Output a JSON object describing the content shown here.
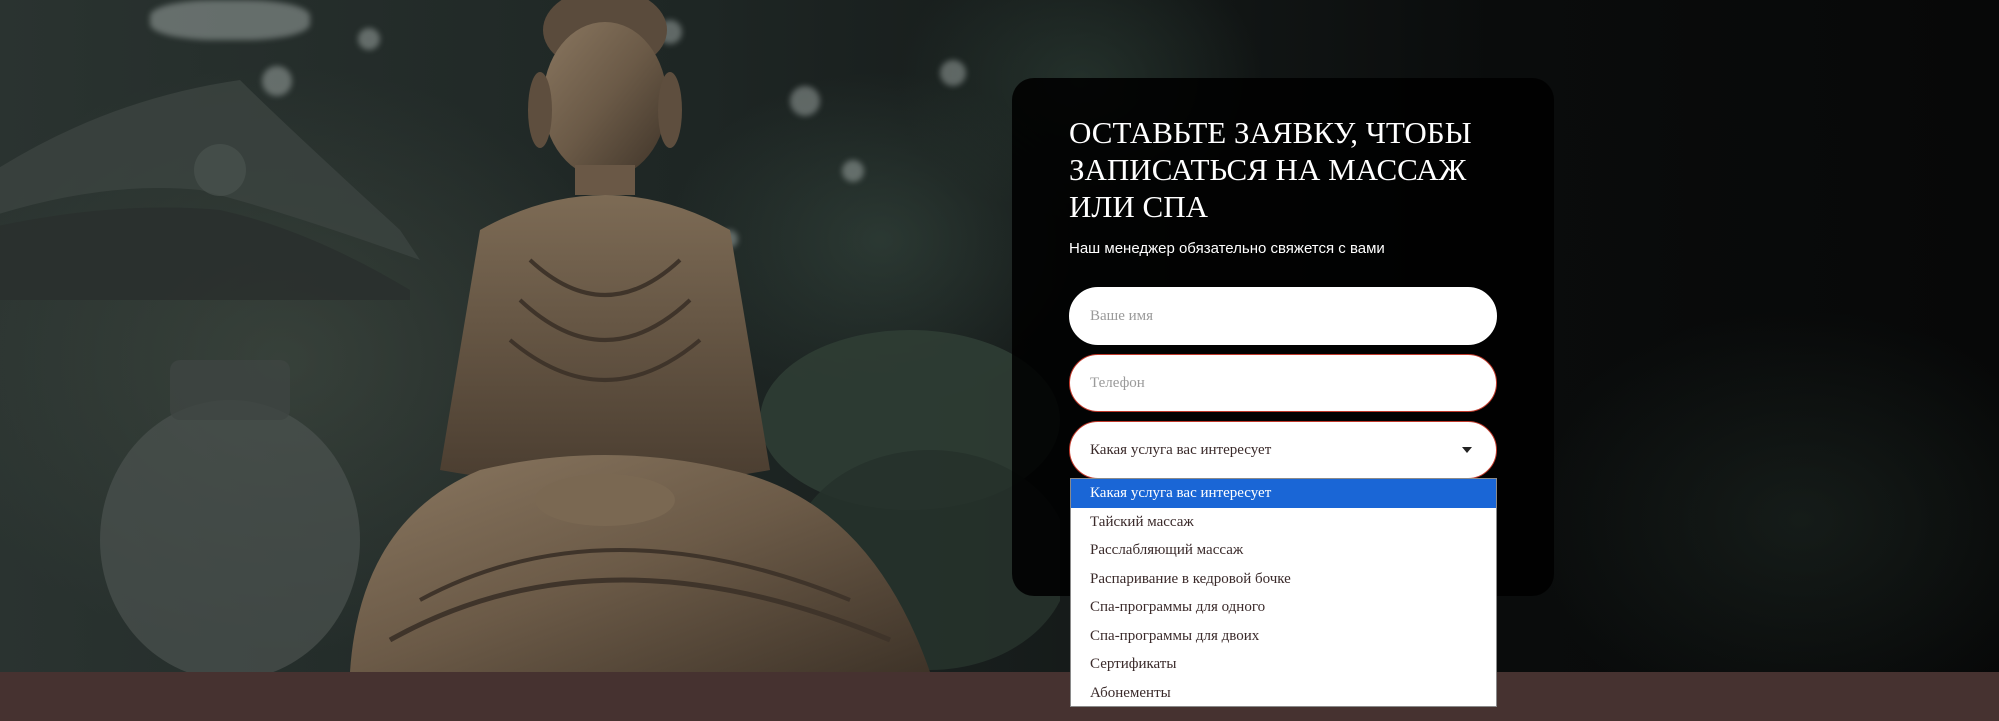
{
  "form": {
    "title": "ОСТАВЬТЕ ЗАЯВКУ, ЧТОБЫ ЗАПИСАТЬСЯ НА МАССАЖ ИЛИ СПА",
    "subtitle": "Наш менеджер обязательно свяжется с вами",
    "name_placeholder": "Ваше имя",
    "phone_placeholder": "Телефон",
    "service_selected": "Какая услуга вас интересует"
  },
  "dropdown": {
    "options": [
      "Какая услуга вас интересует",
      "Тайский массаж",
      "Расслабляющий массаж",
      "Распаривание в кедровой бочке",
      "Спа-программы для одного",
      "Спа-программы для двоих",
      "Сертификаты",
      "Абонементы"
    ],
    "highlighted_index": 0
  },
  "colors": {
    "highlight": "#1a66d6",
    "footer_band": "#463230",
    "error_border": "#c0392b"
  },
  "icons": {
    "select_arrow": "chevron-down-icon"
  }
}
